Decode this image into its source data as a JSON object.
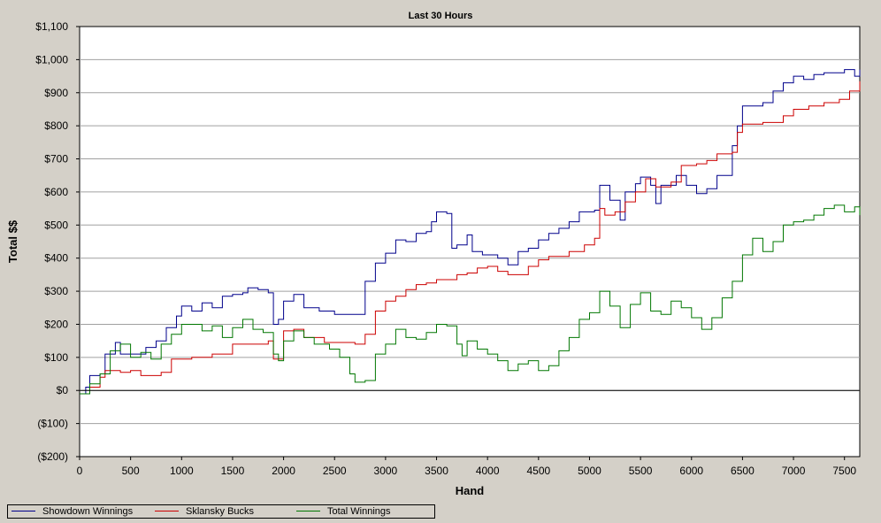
{
  "chart_data": {
    "type": "line",
    "title": "Last 30 Hours",
    "xlabel": "Hand",
    "ylabel": "Total $$",
    "xlim": [
      0,
      7650
    ],
    "ylim": [
      -200,
      1100
    ],
    "xticks": [
      0,
      500,
      1000,
      1500,
      2000,
      2500,
      3000,
      3500,
      4000,
      4500,
      5000,
      5500,
      6000,
      6500,
      7000,
      7500
    ],
    "yticks": [
      -200,
      -100,
      0,
      100,
      200,
      300,
      400,
      500,
      600,
      700,
      800,
      900,
      1000,
      1100
    ],
    "ytick_labels": [
      "($200)",
      "($100)",
      "$0",
      "$100",
      "$200",
      "$300",
      "$400",
      "$500",
      "$600",
      "$700",
      "$800",
      "$900",
      "$1,000",
      "$1,100"
    ],
    "grid": "horizontal",
    "legend_position": "bottom",
    "series": [
      {
        "name": "Showdown Winnings",
        "color": "#00008b",
        "points": [
          [
            0,
            -10
          ],
          [
            60,
            10
          ],
          [
            100,
            45
          ],
          [
            200,
            50
          ],
          [
            250,
            110
          ],
          [
            350,
            145
          ],
          [
            400,
            110
          ],
          [
            550,
            110
          ],
          [
            650,
            130
          ],
          [
            750,
            150
          ],
          [
            850,
            190
          ],
          [
            950,
            225
          ],
          [
            1000,
            255
          ],
          [
            1100,
            240
          ],
          [
            1200,
            265
          ],
          [
            1300,
            250
          ],
          [
            1400,
            285
          ],
          [
            1500,
            290
          ],
          [
            1600,
            295
          ],
          [
            1650,
            310
          ],
          [
            1750,
            305
          ],
          [
            1850,
            295
          ],
          [
            1900,
            200
          ],
          [
            1950,
            215
          ],
          [
            2000,
            270
          ],
          [
            2100,
            290
          ],
          [
            2200,
            250
          ],
          [
            2350,
            240
          ],
          [
            2500,
            230
          ],
          [
            2700,
            230
          ],
          [
            2800,
            330
          ],
          [
            2900,
            385
          ],
          [
            3000,
            415
          ],
          [
            3100,
            455
          ],
          [
            3200,
            450
          ],
          [
            3300,
            475
          ],
          [
            3400,
            480
          ],
          [
            3450,
            510
          ],
          [
            3500,
            540
          ],
          [
            3600,
            535
          ],
          [
            3650,
            430
          ],
          [
            3700,
            440
          ],
          [
            3800,
            470
          ],
          [
            3850,
            420
          ],
          [
            3950,
            410
          ],
          [
            4100,
            400
          ],
          [
            4200,
            380
          ],
          [
            4300,
            420
          ],
          [
            4400,
            430
          ],
          [
            4500,
            455
          ],
          [
            4600,
            475
          ],
          [
            4700,
            490
          ],
          [
            4800,
            510
          ],
          [
            4900,
            540
          ],
          [
            5050,
            545
          ],
          [
            5100,
            620
          ],
          [
            5200,
            575
          ],
          [
            5300,
            515
          ],
          [
            5350,
            600
          ],
          [
            5450,
            625
          ],
          [
            5500,
            645
          ],
          [
            5600,
            620
          ],
          [
            5650,
            565
          ],
          [
            5700,
            620
          ],
          [
            5850,
            650
          ],
          [
            5950,
            620
          ],
          [
            6050,
            595
          ],
          [
            6150,
            610
          ],
          [
            6250,
            650
          ],
          [
            6400,
            740
          ],
          [
            6450,
            800
          ],
          [
            6500,
            860
          ],
          [
            6650,
            860
          ],
          [
            6700,
            870
          ],
          [
            6800,
            905
          ],
          [
            6900,
            930
          ],
          [
            7000,
            950
          ],
          [
            7100,
            940
          ],
          [
            7200,
            955
          ],
          [
            7300,
            960
          ],
          [
            7500,
            970
          ],
          [
            7600,
            950
          ],
          [
            7650,
            970
          ]
        ]
      },
      {
        "name": "Sklansky Bucks",
        "color": "#cc0000",
        "points": [
          [
            0,
            -10
          ],
          [
            100,
            10
          ],
          [
            200,
            40
          ],
          [
            250,
            60
          ],
          [
            400,
            55
          ],
          [
            500,
            60
          ],
          [
            600,
            45
          ],
          [
            800,
            55
          ],
          [
            900,
            95
          ],
          [
            1100,
            100
          ],
          [
            1200,
            100
          ],
          [
            1300,
            110
          ],
          [
            1500,
            140
          ],
          [
            1700,
            140
          ],
          [
            1850,
            150
          ],
          [
            1900,
            95
          ],
          [
            2000,
            180
          ],
          [
            2100,
            185
          ],
          [
            2200,
            160
          ],
          [
            2400,
            145
          ],
          [
            2600,
            145
          ],
          [
            2700,
            140
          ],
          [
            2800,
            170
          ],
          [
            2900,
            240
          ],
          [
            3000,
            270
          ],
          [
            3100,
            285
          ],
          [
            3200,
            305
          ],
          [
            3300,
            320
          ],
          [
            3400,
            325
          ],
          [
            3500,
            335
          ],
          [
            3700,
            350
          ],
          [
            3800,
            355
          ],
          [
            3900,
            370
          ],
          [
            4000,
            375
          ],
          [
            4100,
            360
          ],
          [
            4200,
            350
          ],
          [
            4400,
            375
          ],
          [
            4500,
            395
          ],
          [
            4600,
            405
          ],
          [
            4800,
            420
          ],
          [
            4950,
            440
          ],
          [
            5050,
            460
          ],
          [
            5100,
            550
          ],
          [
            5150,
            530
          ],
          [
            5250,
            540
          ],
          [
            5350,
            570
          ],
          [
            5450,
            600
          ],
          [
            5550,
            640
          ],
          [
            5650,
            615
          ],
          [
            5800,
            630
          ],
          [
            5900,
            680
          ],
          [
            6050,
            685
          ],
          [
            6150,
            695
          ],
          [
            6250,
            715
          ],
          [
            6400,
            720
          ],
          [
            6450,
            780
          ],
          [
            6500,
            805
          ],
          [
            6700,
            810
          ],
          [
            6900,
            830
          ],
          [
            7000,
            850
          ],
          [
            7150,
            860
          ],
          [
            7300,
            870
          ],
          [
            7450,
            880
          ],
          [
            7550,
            905
          ],
          [
            7650,
            935
          ]
        ]
      },
      {
        "name": "Total Winnings",
        "color": "#007700",
        "points": [
          [
            0,
            -10
          ],
          [
            100,
            20
          ],
          [
            200,
            50
          ],
          [
            300,
            120
          ],
          [
            400,
            140
          ],
          [
            500,
            100
          ],
          [
            600,
            115
          ],
          [
            700,
            95
          ],
          [
            800,
            140
          ],
          [
            900,
            170
          ],
          [
            1000,
            200
          ],
          [
            1100,
            200
          ],
          [
            1200,
            180
          ],
          [
            1300,
            195
          ],
          [
            1400,
            160
          ],
          [
            1500,
            190
          ],
          [
            1600,
            215
          ],
          [
            1700,
            185
          ],
          [
            1800,
            175
          ],
          [
            1900,
            110
          ],
          [
            1950,
            90
          ],
          [
            2000,
            150
          ],
          [
            2100,
            180
          ],
          [
            2200,
            160
          ],
          [
            2300,
            140
          ],
          [
            2450,
            125
          ],
          [
            2550,
            100
          ],
          [
            2650,
            50
          ],
          [
            2700,
            25
          ],
          [
            2800,
            30
          ],
          [
            2900,
            110
          ],
          [
            3000,
            140
          ],
          [
            3100,
            185
          ],
          [
            3200,
            160
          ],
          [
            3300,
            155
          ],
          [
            3400,
            175
          ],
          [
            3500,
            200
          ],
          [
            3600,
            195
          ],
          [
            3700,
            140
          ],
          [
            3750,
            105
          ],
          [
            3800,
            150
          ],
          [
            3900,
            125
          ],
          [
            4000,
            110
          ],
          [
            4100,
            90
          ],
          [
            4200,
            60
          ],
          [
            4300,
            80
          ],
          [
            4400,
            90
          ],
          [
            4500,
            60
          ],
          [
            4600,
            75
          ],
          [
            4700,
            120
          ],
          [
            4800,
            160
          ],
          [
            4900,
            215
          ],
          [
            5000,
            235
          ],
          [
            5100,
            300
          ],
          [
            5200,
            255
          ],
          [
            5300,
            190
          ],
          [
            5400,
            260
          ],
          [
            5500,
            295
          ],
          [
            5600,
            240
          ],
          [
            5700,
            230
          ],
          [
            5800,
            270
          ],
          [
            5900,
            250
          ],
          [
            6000,
            220
          ],
          [
            6100,
            185
          ],
          [
            6200,
            220
          ],
          [
            6300,
            280
          ],
          [
            6400,
            330
          ],
          [
            6500,
            410
          ],
          [
            6600,
            460
          ],
          [
            6700,
            420
          ],
          [
            6800,
            450
          ],
          [
            6900,
            500
          ],
          [
            7000,
            510
          ],
          [
            7100,
            515
          ],
          [
            7200,
            530
          ],
          [
            7300,
            550
          ],
          [
            7400,
            560
          ],
          [
            7500,
            540
          ],
          [
            7600,
            555
          ],
          [
            7650,
            530
          ]
        ]
      },
      {
        "name": "",
        "color": "#000000",
        "points": [
          [
            0,
            0
          ],
          [
            7650,
            0
          ]
        ]
      }
    ]
  }
}
